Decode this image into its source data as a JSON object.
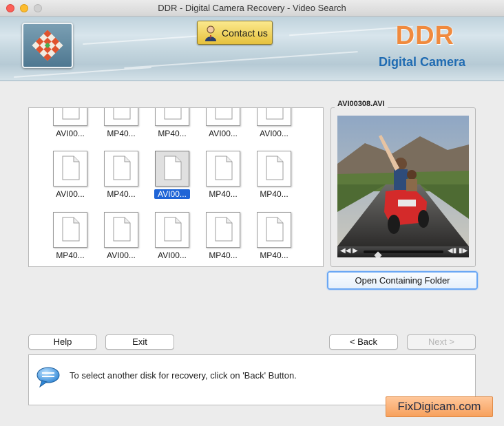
{
  "window": {
    "title": "DDR - Digital Camera Recovery - Video Search"
  },
  "header": {
    "contact_label": "Contact us",
    "brand_title": "DDR",
    "brand_subtitle": "Digital Camera",
    "brand_color": "#f08a3e",
    "subtitle_color": "#1f6bb2"
  },
  "file_grid": {
    "rows": [
      [
        "AVI00...",
        "MP40...",
        "MP40...",
        "AVI00...",
        "AVI00..."
      ],
      [
        "AVI00...",
        "MP40...",
        "AVI00...",
        "MP40...",
        "MP40..."
      ],
      [
        "MP40...",
        "AVI00...",
        "AVI00...",
        "MP40...",
        "MP40..."
      ]
    ],
    "selected": {
      "row": 1,
      "col": 2
    },
    "scroll_position": 0.61
  },
  "preview": {
    "title": "AVI00308.AVI",
    "open_folder_label": "Open Containing Folder",
    "playback_position": 0.16
  },
  "buttons": {
    "help": "Help",
    "exit": "Exit",
    "back": "< Back",
    "next": "Next >"
  },
  "status": {
    "message": "To select another disk for recovery, click on 'Back' Button."
  },
  "watermark": "FixDigicam.com",
  "colors": {
    "selection": "#1e64d6",
    "focus_ring": "#6aa7f4"
  }
}
